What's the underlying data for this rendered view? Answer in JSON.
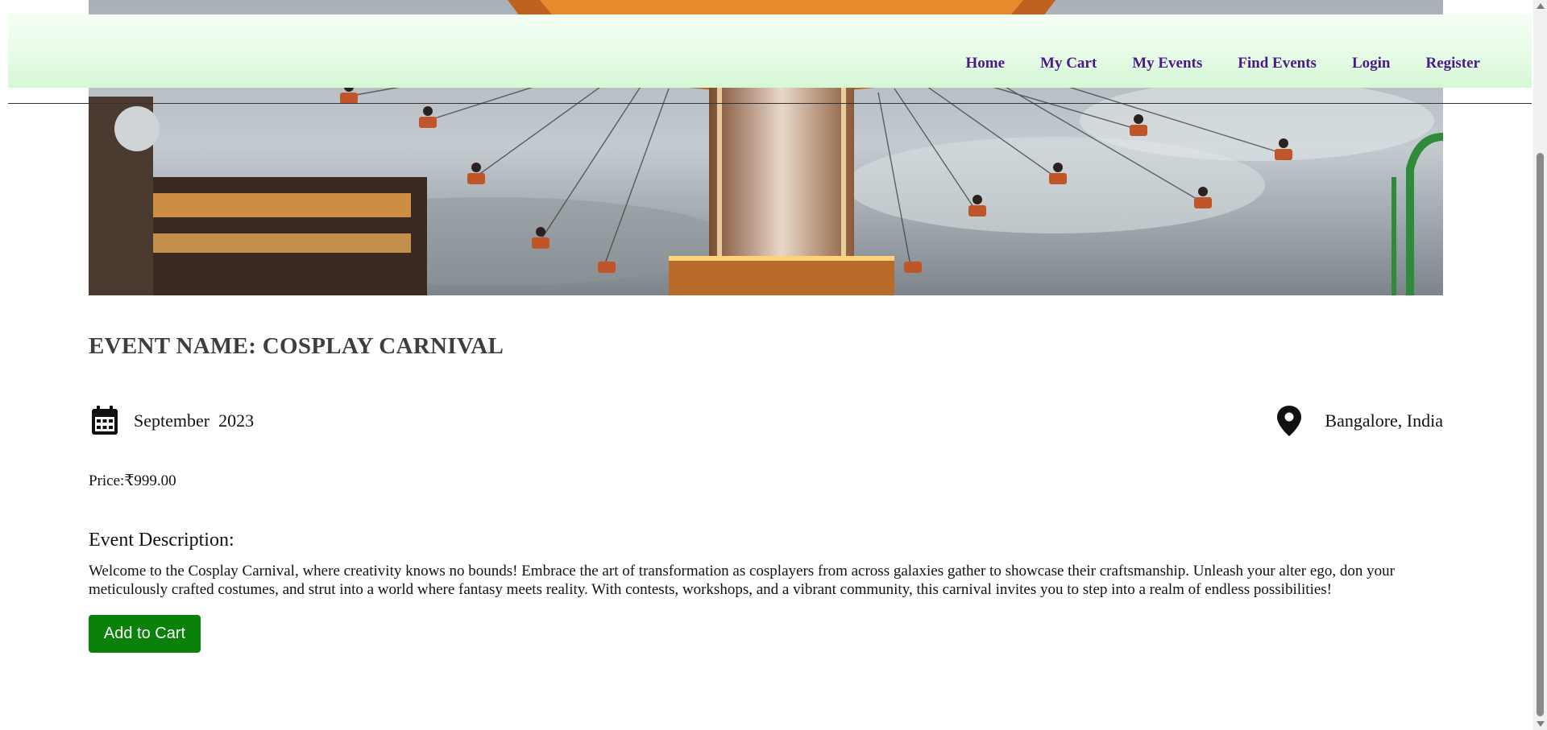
{
  "nav": {
    "links": [
      "Home",
      "My Cart",
      "My Events",
      "Find Events",
      "Login",
      "Register"
    ],
    "link_color": "#4b1a8a"
  },
  "hero": {
    "icon": "carnival-swing-ride-photo"
  },
  "event": {
    "title": "EVENT NAME: COSPLAY CARNIVAL",
    "date": "September  2023",
    "date_icon": "calendar-icon",
    "location": "Bangalore, India",
    "location_icon": "map-pin-icon",
    "price": "Price:₹999.00",
    "description_heading": "Event Description:",
    "description": "Welcome to the Cosplay Carnival, where creativity knows no bounds! Embrace the art of transformation as cosplayers from across galaxies gather to showcase their craftsmanship. Unleash your alter ego, don your meticulously crafted costumes, and strut into a world where fantasy meets reality. With contests, workshops, and a vibrant community, this carnival invites you to step into a realm of endless possibilities!"
  },
  "actions": {
    "add_to_cart": "Add to Cart",
    "button_color": "#0a820a"
  },
  "colors": {
    "navbar_bg": "#e6fbe6",
    "title_text": "#3e3e3e"
  }
}
